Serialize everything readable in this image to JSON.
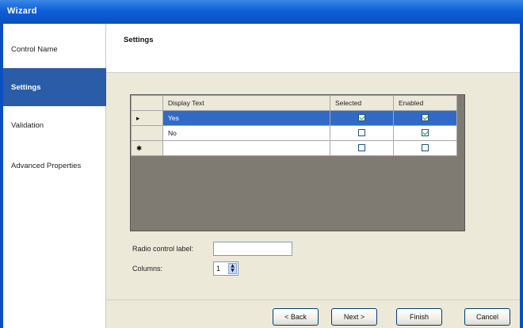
{
  "window": {
    "title": "Wizard"
  },
  "sidebar": {
    "items": [
      {
        "label": "Control Name",
        "active": false
      },
      {
        "label": "Settings",
        "active": true
      },
      {
        "label": "Validation",
        "active": false
      },
      {
        "label": "Advanced Properties",
        "active": false
      }
    ]
  },
  "header": {
    "title": "Settings"
  },
  "grid": {
    "columns": [
      "Display Text",
      "Selected",
      "Enabled"
    ],
    "rows": [
      {
        "indicator": "▸",
        "display_text": "Yes",
        "selected": true,
        "enabled": true,
        "highlighted": true
      },
      {
        "indicator": "",
        "display_text": "No",
        "selected": false,
        "enabled": true,
        "highlighted": false
      },
      {
        "indicator": "✱",
        "display_text": "",
        "selected": false,
        "enabled": false,
        "highlighted": false
      }
    ]
  },
  "form": {
    "radio_label": {
      "label": "Radio control label:",
      "value": ""
    },
    "columns": {
      "label": "Columns:",
      "value": "1"
    }
  },
  "footer": {
    "back_label": "< Back",
    "next_label": "Next >",
    "finish_label": "Finish",
    "cancel_label": "Cancel"
  },
  "colors": {
    "title_bar": "#0a4fc2",
    "sidebar_active": "#2a5ca8",
    "selection": "#316ac5",
    "dialog_face": "#ece9d8",
    "grid_background": "#7f7b73"
  }
}
